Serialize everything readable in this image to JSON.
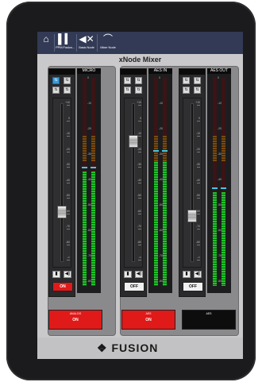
{
  "app": {
    "title": "xNode Mixer",
    "brand": "FUSION",
    "logo_mark": "❖"
  },
  "toolbar": [
    {
      "icon": "⌂",
      "label": "",
      "name": "home"
    },
    {
      "icon": "▌▍",
      "label": "PPM Fusion...",
      "name": "ppm-fusion"
    },
    {
      "icon": "◀✕",
      "label": "Basic Node",
      "name": "basic-node"
    },
    {
      "icon": "⌒",
      "label": "Mixer Node",
      "name": "mixer-node"
    }
  ],
  "channels": [
    {
      "id": "micro",
      "title": "MICRO",
      "label": "",
      "buttons_row1": [
        "⇅",
        "⇅"
      ],
      "buttons_row2": [
        "⇅",
        "⇅"
      ],
      "selected_button": 0,
      "fader_value": 0.3,
      "meter_levels": [
        0.55,
        0.55
      ],
      "onoff": "ON",
      "onoff_state": "on",
      "big_label": "ANALOG",
      "big_value": "ON",
      "big_state": "on"
    },
    {
      "id": "aes-in",
      "title": "AES IN",
      "label": "",
      "buttons_row1": [
        "⇅",
        "⇅"
      ],
      "buttons_row2": [
        "⇅",
        "⇅"
      ],
      "selected_button": -1,
      "fader_value": 0.78,
      "meter_levels": [
        0.63,
        0.63
      ],
      "onoff": "OFF",
      "onoff_state": "off",
      "big_label": "AES",
      "big_value": "ON",
      "big_state": "on"
    },
    {
      "id": "aes-out",
      "title": "AES OUT",
      "label": "",
      "buttons_row1": [
        "⇅",
        "⇅"
      ],
      "buttons_row2": [
        "⇅",
        "⇅"
      ],
      "selected_button": -1,
      "fader_value": 0.27,
      "meter_levels": [
        0.45,
        0.45
      ],
      "onoff": "OFF",
      "onoff_state": "off",
      "big_label": "AES",
      "big_value": "",
      "big_state": "off"
    }
  ],
  "fader_scale": [
    "+10",
    "0",
    "-10",
    "-20",
    "-30",
    "-40",
    "-50",
    "-60",
    "-70",
    "-80",
    "-∞"
  ],
  "meter_scale": [
    "0",
    "-10",
    "-20",
    "-30",
    "-40",
    "-50",
    "-60",
    "-70",
    "-80"
  ],
  "icon_buttons": {
    "mute": "▮",
    "speaker": "◀)"
  }
}
